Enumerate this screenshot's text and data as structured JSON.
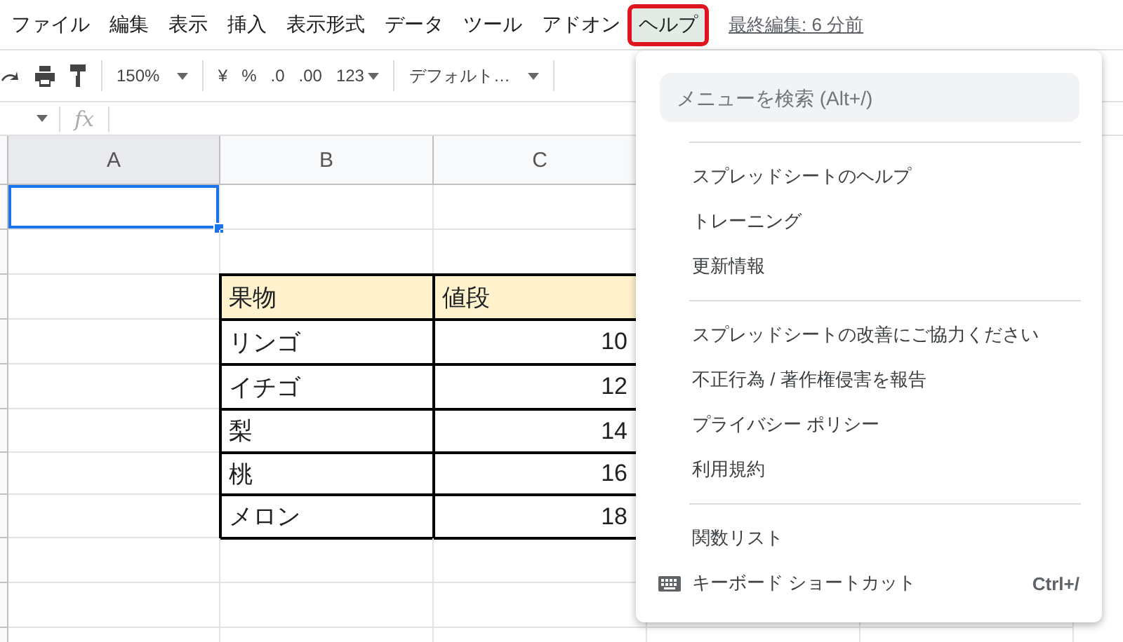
{
  "menubar": {
    "items": [
      {
        "label": "ファイル",
        "selected": false
      },
      {
        "label": "編集",
        "selected": false
      },
      {
        "label": "表示",
        "selected": false
      },
      {
        "label": "挿入",
        "selected": false
      },
      {
        "label": "表示形式",
        "selected": false
      },
      {
        "label": "データ",
        "selected": false
      },
      {
        "label": "ツール",
        "selected": false
      },
      {
        "label": "アドオン",
        "selected": false
      },
      {
        "label": "ヘルプ",
        "selected": true
      }
    ],
    "last_edit": "最終編集: 6 分前"
  },
  "toolbar": {
    "zoom": "150%",
    "currency": "¥",
    "percent": "%",
    "decimal_decrease": ".0",
    "decimal_increase": ".00",
    "number_format": "123",
    "font": "デフォルト…"
  },
  "formula_bar": {
    "fx": "fx"
  },
  "columns": [
    "A",
    "B",
    "C"
  ],
  "sheet": {
    "first_cell_selected": true,
    "table": {
      "header": [
        "果物",
        "値段"
      ],
      "rows": [
        [
          "リンゴ",
          "10"
        ],
        [
          "イチゴ",
          "12"
        ],
        [
          "梨",
          "14"
        ],
        [
          "桃",
          "16"
        ],
        [
          "メロン",
          "18"
        ]
      ]
    }
  },
  "help_menu": {
    "search": {
      "placeholder": "メニューを検索 (Alt+/)"
    },
    "groups": [
      [
        {
          "label": "スプレッドシートのヘルプ"
        },
        {
          "label": "トレーニング"
        },
        {
          "label": "更新情報"
        }
      ],
      [
        {
          "label": "スプレッドシートの改善にご協力ください"
        },
        {
          "label": "不正行為 / 著作権侵害を報告"
        },
        {
          "label": "プライバシー ポリシー"
        },
        {
          "label": "利用規約"
        }
      ],
      [
        {
          "label": "関数リスト"
        },
        {
          "label": "キーボード ショートカット",
          "kind": "keyboard",
          "shortcut": "Ctrl+/"
        }
      ]
    ]
  }
}
